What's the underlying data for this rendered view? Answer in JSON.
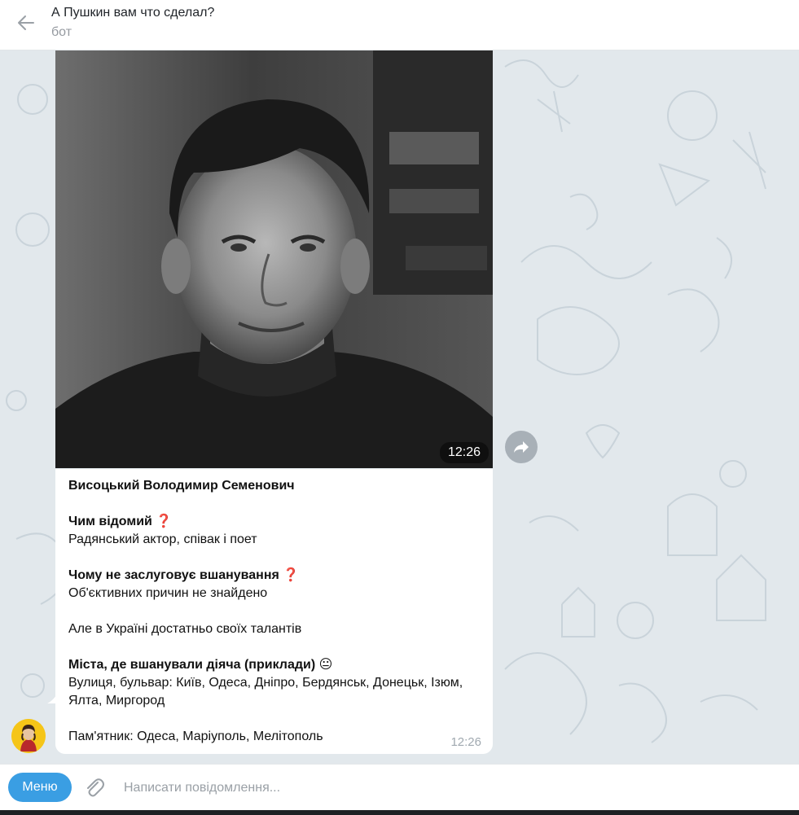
{
  "header": {
    "title": "А Пушкин вам что сделал?",
    "subtitle": "бот",
    "back_icon": "arrow-left-icon"
  },
  "message": {
    "photo_time": "12:26",
    "photo_description_icon": "portrait-photo",
    "lines": [
      {
        "text": "Висоцький Володимир Семенович",
        "bold": true
      },
      {
        "text": "Чим відомий",
        "bold": true,
        "emoji": "❓"
      },
      {
        "text": "Радянський актор, співак і поет",
        "bold": false
      },
      {
        "text": "Чому не заслуговує вшанування",
        "bold": true,
        "emoji": "❓"
      },
      {
        "text": "Об'єктивних причин не знайдено",
        "bold": false
      },
      {
        "text": "Але в Україні достатньо своїх талантів",
        "bold": false
      },
      {
        "text": "Міста, де вшанували діяча (приклади)",
        "bold": true,
        "emoji": "😐"
      },
      {
        "text": "Вулиця, бульвар: Київ, Одеса, Дніпро, Бердянськ, Донецьк, Ізюм,",
        "bold": false
      },
      {
        "text": "Ялта, Миргород",
        "bold": false
      },
      {
        "text": "Пам'ятник: Одеса, Маріуполь, Мелітополь",
        "bold": false
      }
    ],
    "time": "12:26",
    "forward_icon": "forward-arrow-icon"
  },
  "composer": {
    "menu_label": "Меню",
    "attach_icon": "paperclip-icon",
    "placeholder": "Написати повідомлення..."
  },
  "colors": {
    "accent": "#3a9ee3",
    "question_mark": "#d6262c",
    "chat_background": "#e2e8ec"
  }
}
